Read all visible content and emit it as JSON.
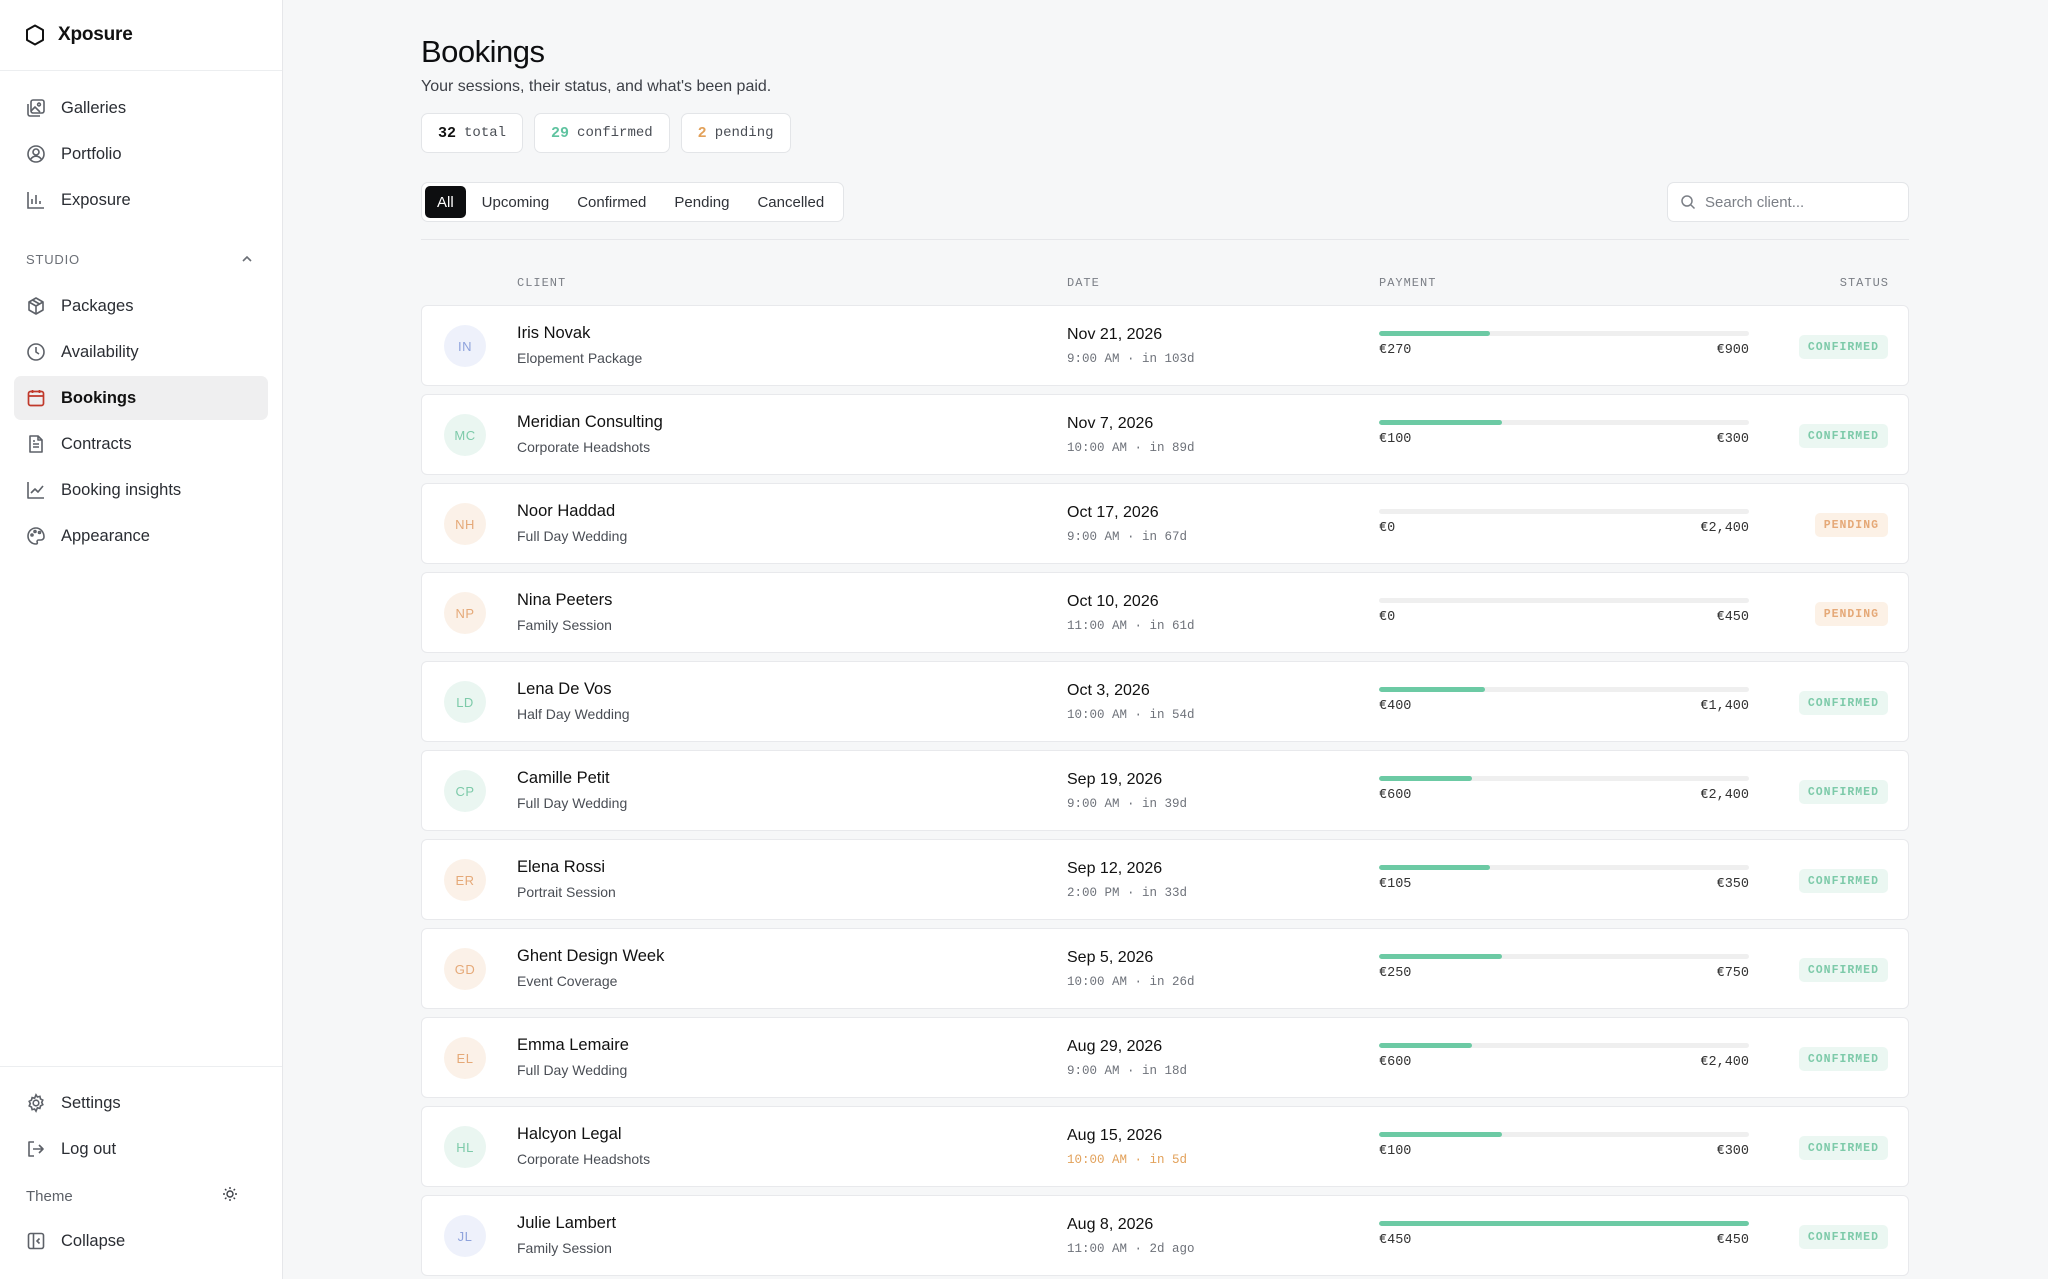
{
  "app": {
    "name": "Xposure"
  },
  "sidebar": {
    "top_items": [
      {
        "label": "Galleries",
        "icon": "galleries-icon"
      },
      {
        "label": "Portfolio",
        "icon": "portfolio-icon"
      },
      {
        "label": "Exposure",
        "icon": "exposure-icon"
      }
    ],
    "section_label": "STUDIO",
    "studio_items": [
      {
        "label": "Packages",
        "icon": "package-icon"
      },
      {
        "label": "Availability",
        "icon": "clock-icon"
      },
      {
        "label": "Bookings",
        "icon": "calendar-icon",
        "active": true
      },
      {
        "label": "Contracts",
        "icon": "document-icon"
      },
      {
        "label": "Booking insights",
        "icon": "line-chart-icon"
      },
      {
        "label": "Appearance",
        "icon": "palette-icon"
      }
    ],
    "settings": "Settings",
    "logout": "Log out",
    "theme": "Theme",
    "collapse": "Collapse"
  },
  "header": {
    "title": "Bookings",
    "subtitle": "Your sessions, their status, and what's been paid."
  },
  "stats": {
    "total": {
      "value": "32",
      "label": "total"
    },
    "confirmed": {
      "value": "29",
      "label": "confirmed"
    },
    "pending": {
      "value": "2",
      "label": "pending"
    }
  },
  "tabs": [
    "All",
    "Upcoming",
    "Confirmed",
    "Pending",
    "Cancelled"
  ],
  "active_tab": "All",
  "search": {
    "placeholder": "Search client..."
  },
  "table": {
    "headers": {
      "client": "CLIENT",
      "date": "DATE",
      "payment": "PAYMENT",
      "status": "STATUS"
    },
    "rows": [
      {
        "initials": "IN",
        "tone": "blue",
        "name": "Iris Novak",
        "package": "Elopement Package",
        "date": "Nov 21, 2026",
        "time": "9:00 AM · in 103d",
        "paid": "€270",
        "total": "€900",
        "paid_fraction": 0.3,
        "status": "CONFIRMED",
        "status_kind": "confirmed"
      },
      {
        "initials": "MC",
        "tone": "green",
        "name": "Meridian Consulting",
        "package": "Corporate Headshots",
        "date": "Nov 7, 2026",
        "time": "10:00 AM · in 89d",
        "paid": "€100",
        "total": "€300",
        "paid_fraction": 0.333,
        "status": "CONFIRMED",
        "status_kind": "confirmed"
      },
      {
        "initials": "NH",
        "tone": "orange",
        "name": "Noor Haddad",
        "package": "Full Day Wedding",
        "date": "Oct 17, 2026",
        "time": "9:00 AM · in 67d",
        "paid": "€0",
        "total": "€2,400",
        "paid_fraction": 0,
        "status": "PENDING",
        "status_kind": "pending"
      },
      {
        "initials": "NP",
        "tone": "orange",
        "name": "Nina Peeters",
        "package": "Family Session",
        "date": "Oct 10, 2026",
        "time": "11:00 AM · in 61d",
        "paid": "€0",
        "total": "€450",
        "paid_fraction": 0,
        "status": "PENDING",
        "status_kind": "pending"
      },
      {
        "initials": "LD",
        "tone": "green",
        "name": "Lena De Vos",
        "package": "Half Day Wedding",
        "date": "Oct 3, 2026",
        "time": "10:00 AM · in 54d",
        "paid": "€400",
        "total": "€1,400",
        "paid_fraction": 0.286,
        "status": "CONFIRMED",
        "status_kind": "confirmed"
      },
      {
        "initials": "CP",
        "tone": "green",
        "name": "Camille Petit",
        "package": "Full Day Wedding",
        "date": "Sep 19, 2026",
        "time": "9:00 AM · in 39d",
        "paid": "€600",
        "total": "€2,400",
        "paid_fraction": 0.25,
        "status": "CONFIRMED",
        "status_kind": "confirmed"
      },
      {
        "initials": "ER",
        "tone": "orange",
        "name": "Elena Rossi",
        "package": "Portrait Session",
        "date": "Sep 12, 2026",
        "time": "2:00 PM · in 33d",
        "paid": "€105",
        "total": "€350",
        "paid_fraction": 0.3,
        "status": "CONFIRMED",
        "status_kind": "confirmed"
      },
      {
        "initials": "GD",
        "tone": "orange",
        "name": "Ghent Design Week",
        "package": "Event Coverage",
        "date": "Sep 5, 2026",
        "time": "10:00 AM · in 26d",
        "paid": "€250",
        "total": "€750",
        "paid_fraction": 0.333,
        "status": "CONFIRMED",
        "status_kind": "confirmed"
      },
      {
        "initials": "EL",
        "tone": "orange",
        "name": "Emma Lemaire",
        "package": "Full Day Wedding",
        "date": "Aug 29, 2026",
        "time": "9:00 AM · in 18d",
        "paid": "€600",
        "total": "€2,400",
        "paid_fraction": 0.25,
        "status": "CONFIRMED",
        "status_kind": "confirmed"
      },
      {
        "initials": "HL",
        "tone": "green",
        "name": "Halcyon Legal",
        "package": "Corporate Headshots",
        "date": "Aug 15, 2026",
        "time": "10:00 AM · in 5d",
        "time_warn": true,
        "paid": "€100",
        "total": "€300",
        "paid_fraction": 0.333,
        "status": "CONFIRMED",
        "status_kind": "confirmed"
      },
      {
        "initials": "JL",
        "tone": "blue",
        "name": "Julie Lambert",
        "package": "Family Session",
        "date": "Aug 8, 2026",
        "time": "11:00 AM · 2d ago",
        "paid": "€450",
        "total": "€450",
        "paid_fraction": 1.0,
        "status": "CONFIRMED",
        "status_kind": "confirmed"
      }
    ]
  },
  "colors": {
    "accent_green": "#6ccaa4",
    "accent_orange": "#e2a15a",
    "active_icon": "#c0392b"
  }
}
